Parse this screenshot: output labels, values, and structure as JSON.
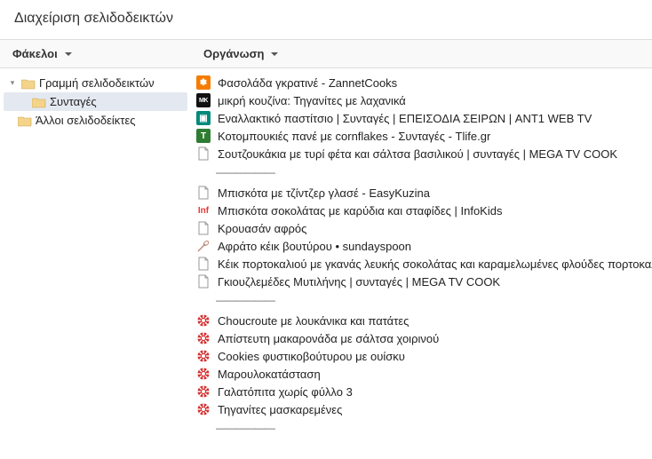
{
  "window": {
    "title": "Διαχείριση σελιδοδεικτών"
  },
  "toolbar": {
    "folders_label": "Φάκελοι",
    "organize_label": "Οργάνωση"
  },
  "tree": {
    "root": "Γραμμή σελιδοδεικτών",
    "selected": "Συνταγές",
    "other": "Άλλοι σελιδοδείκτες"
  },
  "bookmarks": [
    {
      "icon": "orange",
      "label": "Φασολάδα γκρατινέ - ZannetCooks"
    },
    {
      "icon": "black",
      "label": "μικρή κουζίνα: Τηγανίτες με λαχανικά"
    },
    {
      "icon": "teal",
      "label": "Εναλλακτικό παστίτσιο | Συνταγές | ΕΠΕΙΣΟΔΙΑ ΣΕΙΡΩΝ | ANT1 WEB TV"
    },
    {
      "icon": "t",
      "label": "Κοτομπουκιές πανέ με cornflakes - Συνταγές - Tlife.gr"
    },
    {
      "icon": "page",
      "label": "Σουτζουκάκια με τυρί φέτα και σάλτσα βασιλικού | συνταγές | MEGA TV COOK"
    },
    {
      "separator": true
    },
    {
      "icon": "page",
      "label": "Μπισκότα με τζίντζερ γλασέ - EasyKuzina"
    },
    {
      "icon": "inf",
      "label": "Μπισκότα σοκολάτας με καρύδια και σταφίδες | InfoKids"
    },
    {
      "icon": "page",
      "label": "Κρουασάν αφρός"
    },
    {
      "icon": "whisk",
      "label": "Αφράτο κέικ βουτύρου • sundayspoon"
    },
    {
      "icon": "page",
      "label": "Κέικ πορτοκαλιού με γκανάς λευκής σοκολάτας και καραμελωμένες φλούδες πορτοκαλιού"
    },
    {
      "icon": "page",
      "label": "Γκιουζλεμέδες Μυτιλήνης | συνταγές | MEGA TV COOK"
    },
    {
      "separator": true
    },
    {
      "icon": "red",
      "label": "Choucroute με λουκάνικα και πατάτες"
    },
    {
      "icon": "red",
      "label": "Απίστευτη μακαρονάδα με σάλτσα χοιρινού"
    },
    {
      "icon": "red",
      "label": "Cookies φυστικοβούτυρου με ουίσκυ"
    },
    {
      "icon": "red",
      "label": "Μαρουλοκατάσταση"
    },
    {
      "icon": "red",
      "label": "Γαλατόπιτα χωρίς φύλλο 3"
    },
    {
      "icon": "red",
      "label": "Τηγανίτες μασκαρεμένες"
    },
    {
      "separator": true
    }
  ]
}
